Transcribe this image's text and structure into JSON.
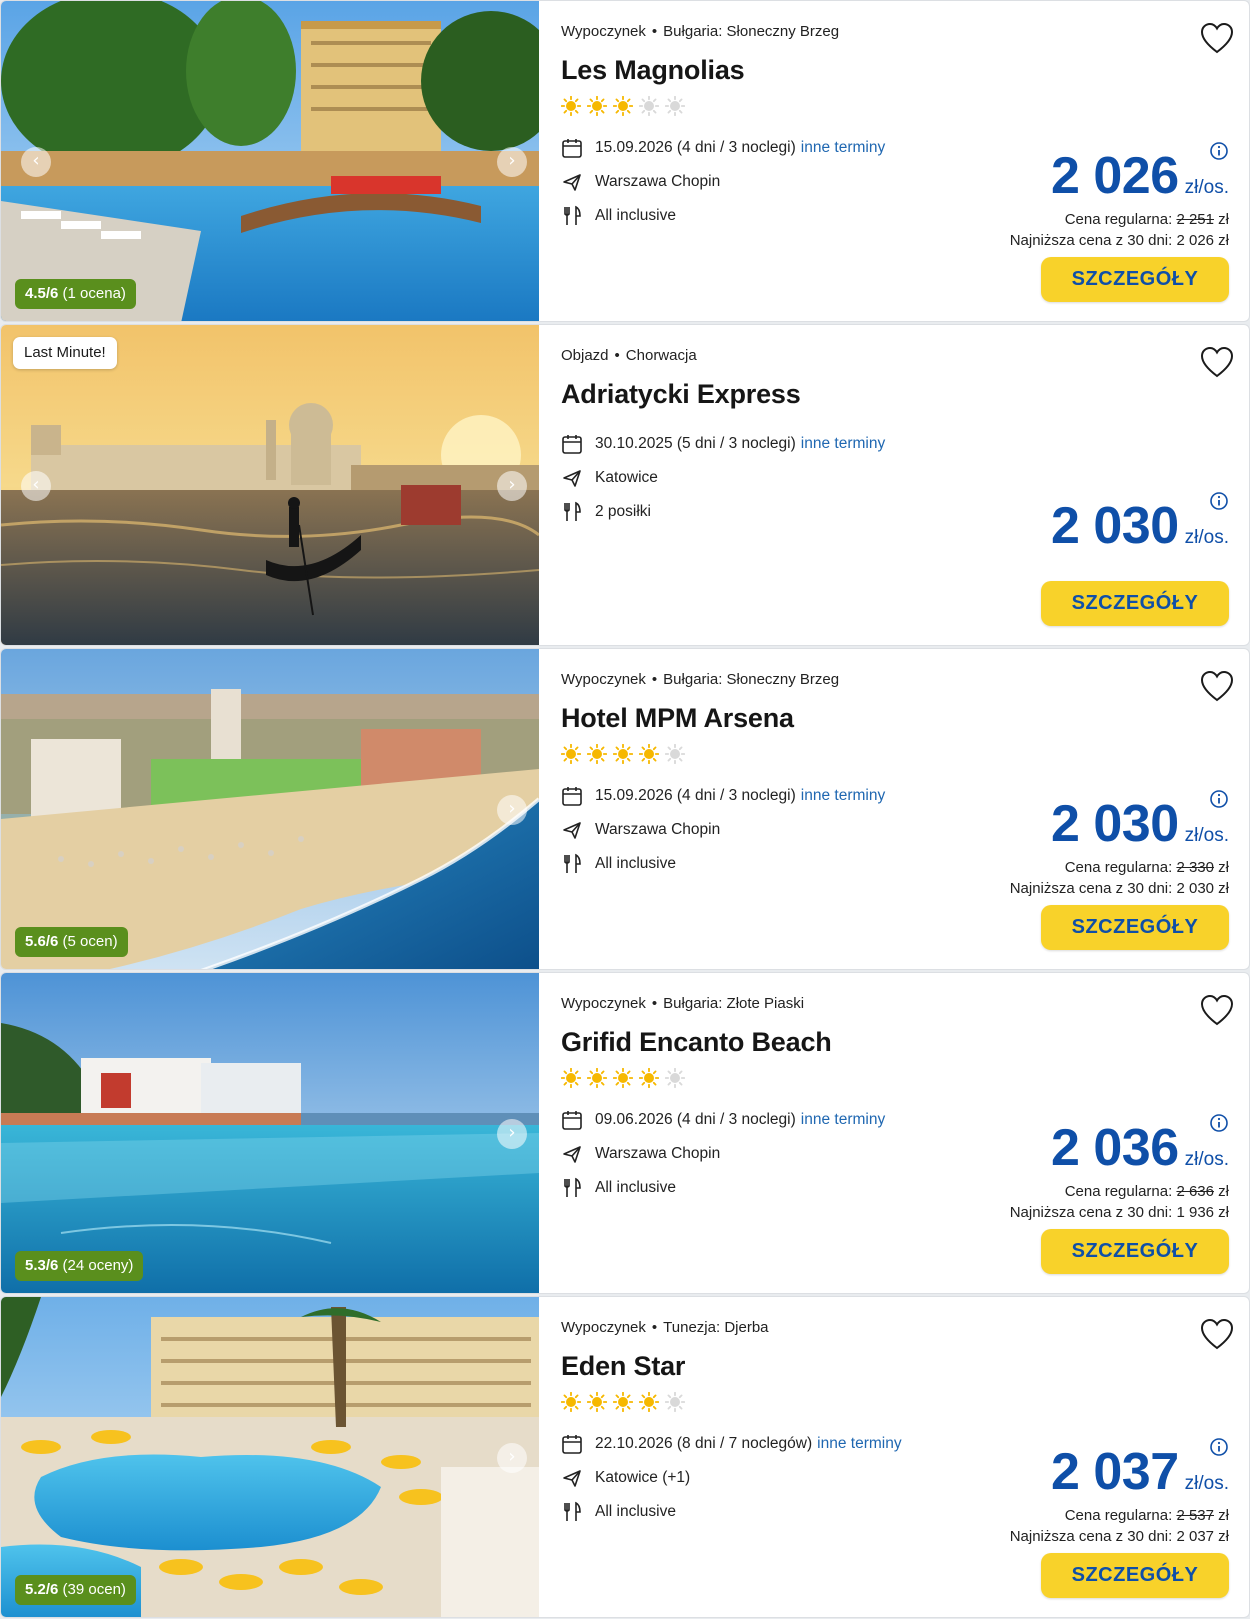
{
  "offers": [
    {
      "category": "Wypoczynek",
      "destination": "Bułgaria: Słoneczny Brzeg",
      "name": "Les Magnolias",
      "stars": 3,
      "date": "15.09.2026 (4 dni / 3 noclegi)",
      "other_dates": "inne terminy",
      "departure": "Warszawa Chopin",
      "board": "All inclusive",
      "price": "2 026",
      "per_person": "zł/os.",
      "regular_label": "Cena regularna:",
      "regular_price": "2 251",
      "currency": "zł",
      "lowest_text": "Najniższa cena z 30 dni: 2 026 zł",
      "rating_score": "4.5/6",
      "rating_count": "(1 ocena)",
      "badge": "",
      "button": "SZCZEGÓŁY"
    },
    {
      "category": "Objazd",
      "destination": "Chorwacja",
      "name": "Adriatycki Express",
      "stars": 0,
      "date": "30.10.2025 (5 dni / 3 noclegi)",
      "other_dates": "inne terminy",
      "departure": "Katowice",
      "board": "2 posiłki",
      "price": "2 030",
      "per_person": "zł/os.",
      "regular_label": "",
      "regular_price": "",
      "currency": "",
      "lowest_text": "",
      "rating_score": "",
      "rating_count": "",
      "badge": "Last Minute!",
      "button": "SZCZEGÓŁY"
    },
    {
      "category": "Wypoczynek",
      "destination": "Bułgaria: Słoneczny Brzeg",
      "name": "Hotel MPM Arsena",
      "stars": 4,
      "date": "15.09.2026 (4 dni / 3 noclegi)",
      "other_dates": "inne terminy",
      "departure": "Warszawa Chopin",
      "board": "All inclusive",
      "price": "2 030",
      "per_person": "zł/os.",
      "regular_label": "Cena regularna:",
      "regular_price": "2 330",
      "currency": "zł",
      "lowest_text": "Najniższa cena z 30 dni: 2 030 zł",
      "rating_score": "5.6/6",
      "rating_count": "(5 ocen)",
      "badge": "",
      "button": "SZCZEGÓŁY"
    },
    {
      "category": "Wypoczynek",
      "destination": "Bułgaria: Złote Piaski",
      "name": "Grifid Encanto Beach",
      "stars": 4,
      "date": "09.06.2026 (4 dni / 3 noclegi)",
      "other_dates": "inne terminy",
      "departure": "Warszawa Chopin",
      "board": "All inclusive",
      "price": "2 036",
      "per_person": "zł/os.",
      "regular_label": "Cena regularna:",
      "regular_price": "2 636",
      "currency": "zł",
      "lowest_text": "Najniższa cena z 30 dni: 1 936 zł",
      "rating_score": "5.3/6",
      "rating_count": "(24 oceny)",
      "badge": "",
      "button": "SZCZEGÓŁY"
    },
    {
      "category": "Wypoczynek",
      "destination": "Tunezja: Djerba",
      "name": "Eden Star",
      "stars": 4,
      "date": "22.10.2026 (8 dni / 7 noclegów)",
      "other_dates": "inne terminy",
      "departure": "Katowice (+1)",
      "board": "All inclusive",
      "price": "2 037",
      "per_person": "zł/os.",
      "regular_label": "Cena regularna:",
      "regular_price": "2 537",
      "currency": "zł",
      "lowest_text": "Najniższa cena z 30 dni: 2 037 zł",
      "rating_score": "5.2/6",
      "rating_count": "(39 ocen)",
      "badge": "",
      "button": "SZCZEGÓŁY"
    }
  ],
  "icons": {
    "favorite": "heart-icon",
    "date": "calendar-icon",
    "departure": "plane-icon",
    "board": "cutlery-icon",
    "price_info": "info-icon",
    "stars": "sun-icon",
    "gallery_prev": "chevron-left-icon",
    "gallery_next": "chevron-right-icon"
  },
  "colors": {
    "price": "#0f4fa8",
    "button": "#f8d22a",
    "rating": "#5a8f1d",
    "link": "#1f67b1",
    "star_on": "#f6b800",
    "star_off": "#d9d9d9"
  }
}
